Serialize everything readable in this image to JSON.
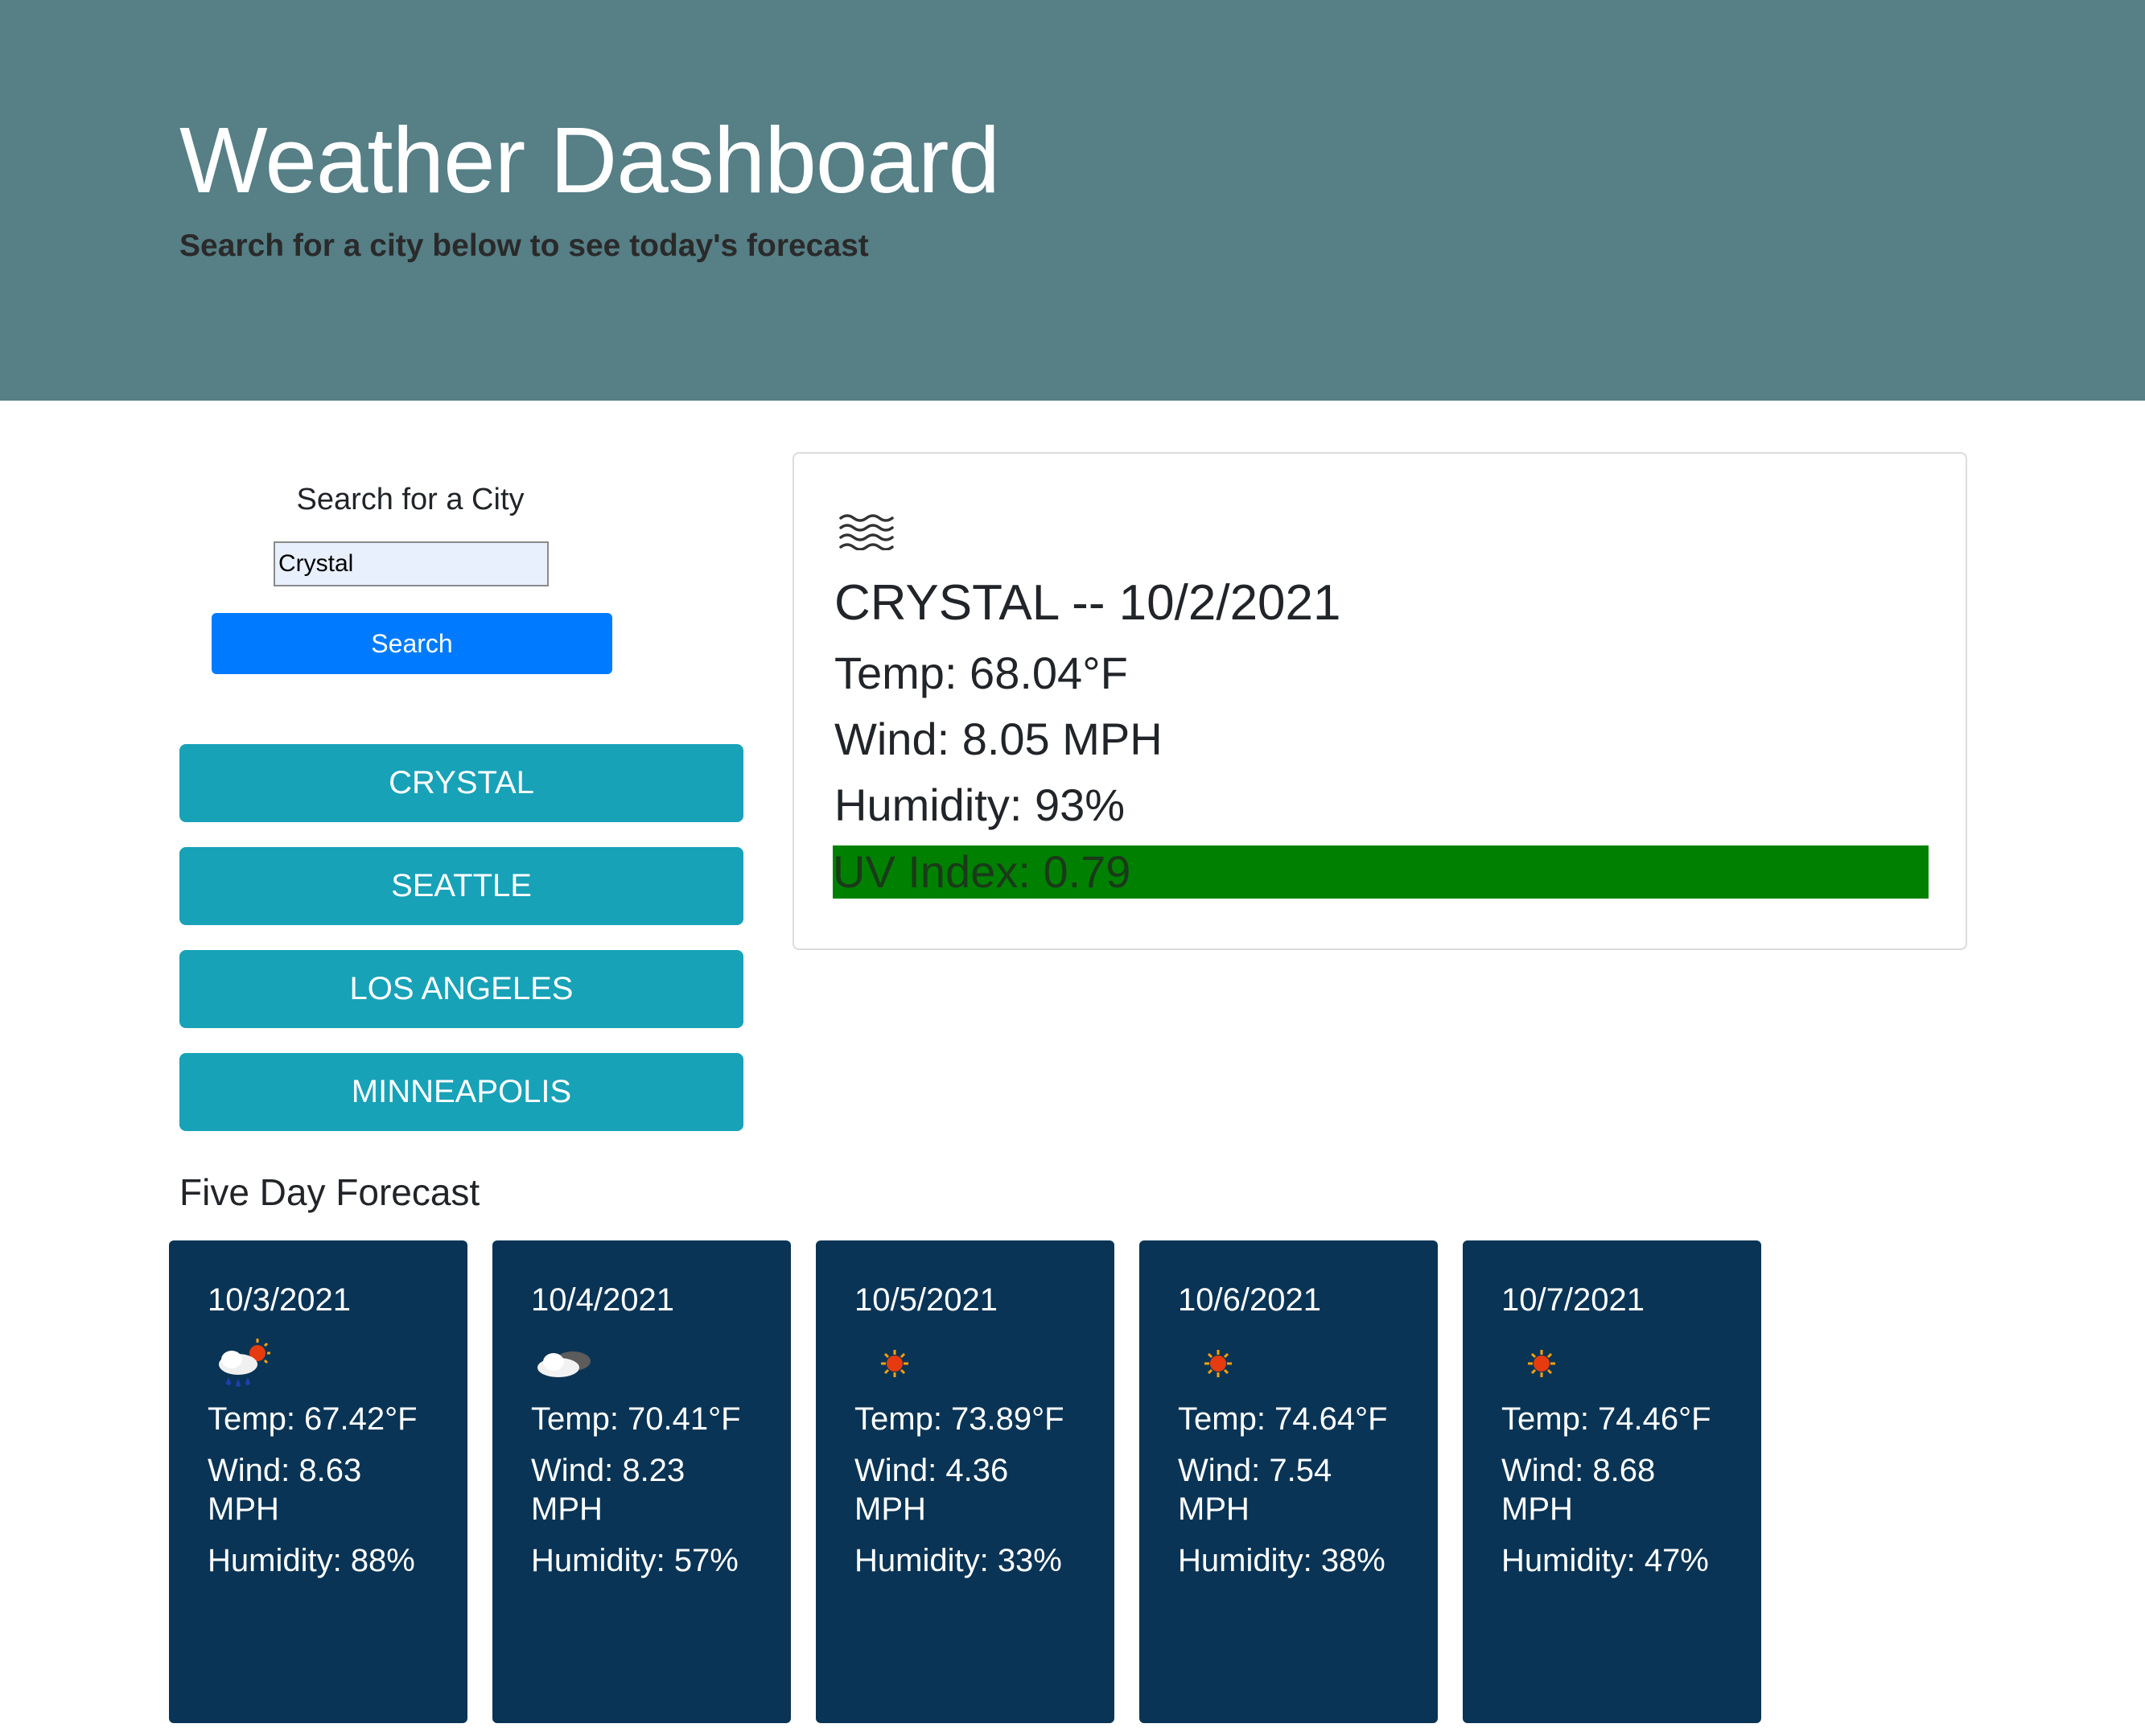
{
  "header": {
    "title": "Weather Dashboard",
    "subtitle": "Search for a city below to see today's forecast"
  },
  "search": {
    "label": "Search for a City",
    "value": "Crystal",
    "button_label": "Search"
  },
  "history": [
    {
      "label": "CRYSTAL"
    },
    {
      "label": "SEATTLE"
    },
    {
      "label": "LOS ANGELES"
    },
    {
      "label": "MINNEAPOLIS"
    }
  ],
  "current": {
    "icon": "mist-icon",
    "city_date": "CRYSTAL -- 10/2/2021",
    "temp": "Temp: 68.04°F",
    "wind": "Wind: 8.05 MPH",
    "humidity": "Humidity: 93%",
    "uv": "UV Index: 0.79",
    "uv_color": "#008000"
  },
  "forecast": {
    "title": "Five Day Forecast",
    "days": [
      {
        "date": "10/3/2021",
        "icon": "rain-sun-icon",
        "temp": "Temp: 67.42°F",
        "wind": "Wind: 8.63 MPH",
        "humidity": "Humidity: 88%"
      },
      {
        "date": "10/4/2021",
        "icon": "cloudy-icon",
        "temp": "Temp: 70.41°F",
        "wind": "Wind: 8.23 MPH",
        "humidity": "Humidity: 57%"
      },
      {
        "date": "10/5/2021",
        "icon": "sun-icon",
        "temp": "Temp: 73.89°F",
        "wind": "Wind: 4.36 MPH",
        "humidity": "Humidity: 33%"
      },
      {
        "date": "10/6/2021",
        "icon": "sun-icon",
        "temp": "Temp: 74.64°F",
        "wind": "Wind: 7.54 MPH",
        "humidity": "Humidity: 38%"
      },
      {
        "date": "10/7/2021",
        "icon": "sun-icon",
        "temp": "Temp: 74.46°F",
        "wind": "Wind: 8.68 MPH",
        "humidity": "Humidity: 47%"
      }
    ]
  },
  "colors": {
    "header_bg": "#567f86",
    "search_button": "#007bff",
    "history_button": "#17a2b8",
    "forecast_card": "#0a3455"
  }
}
